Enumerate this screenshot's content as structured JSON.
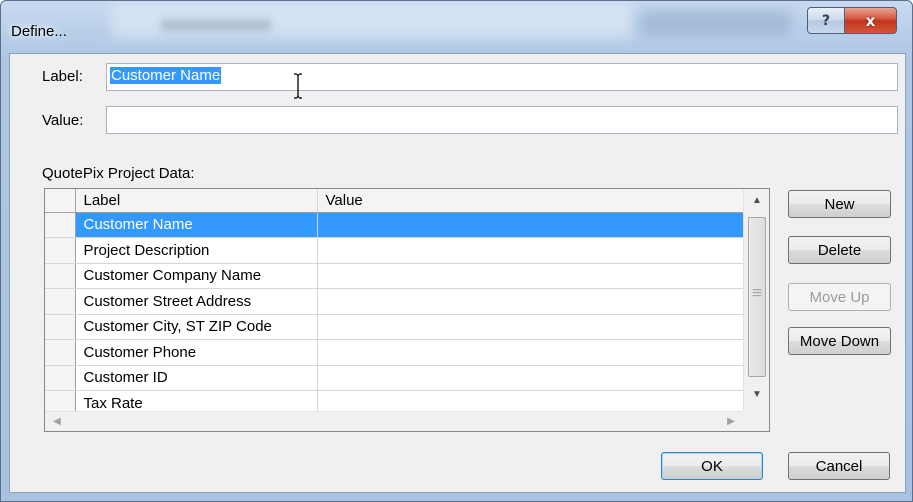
{
  "window": {
    "title": "Define...",
    "help_glyph": "?",
    "close_glyph": "x"
  },
  "form": {
    "label_caption": "Label:",
    "label_value": "Customer Name",
    "value_caption": "Value:",
    "value_value": ""
  },
  "grid": {
    "caption": "QuotePix Project Data:",
    "headers": [
      "Label",
      "Value"
    ],
    "rows": [
      {
        "label": "Customer Name",
        "value": "",
        "selected": true
      },
      {
        "label": "Project Description",
        "value": ""
      },
      {
        "label": "Customer Company Name",
        "value": ""
      },
      {
        "label": "Customer Street Address",
        "value": ""
      },
      {
        "label": "Customer City, ST  ZIP Code",
        "value": ""
      },
      {
        "label": "Customer Phone",
        "value": ""
      },
      {
        "label": "Customer ID",
        "value": ""
      },
      {
        "label": "Tax Rate",
        "value": ""
      }
    ]
  },
  "buttons": {
    "new": "New",
    "delete": "Delete",
    "move_up": "Move Up",
    "move_down": "Move Down",
    "ok": "OK",
    "cancel": "Cancel"
  },
  "colors": {
    "selection": "#3399ff",
    "close_button": "#c0361c"
  }
}
